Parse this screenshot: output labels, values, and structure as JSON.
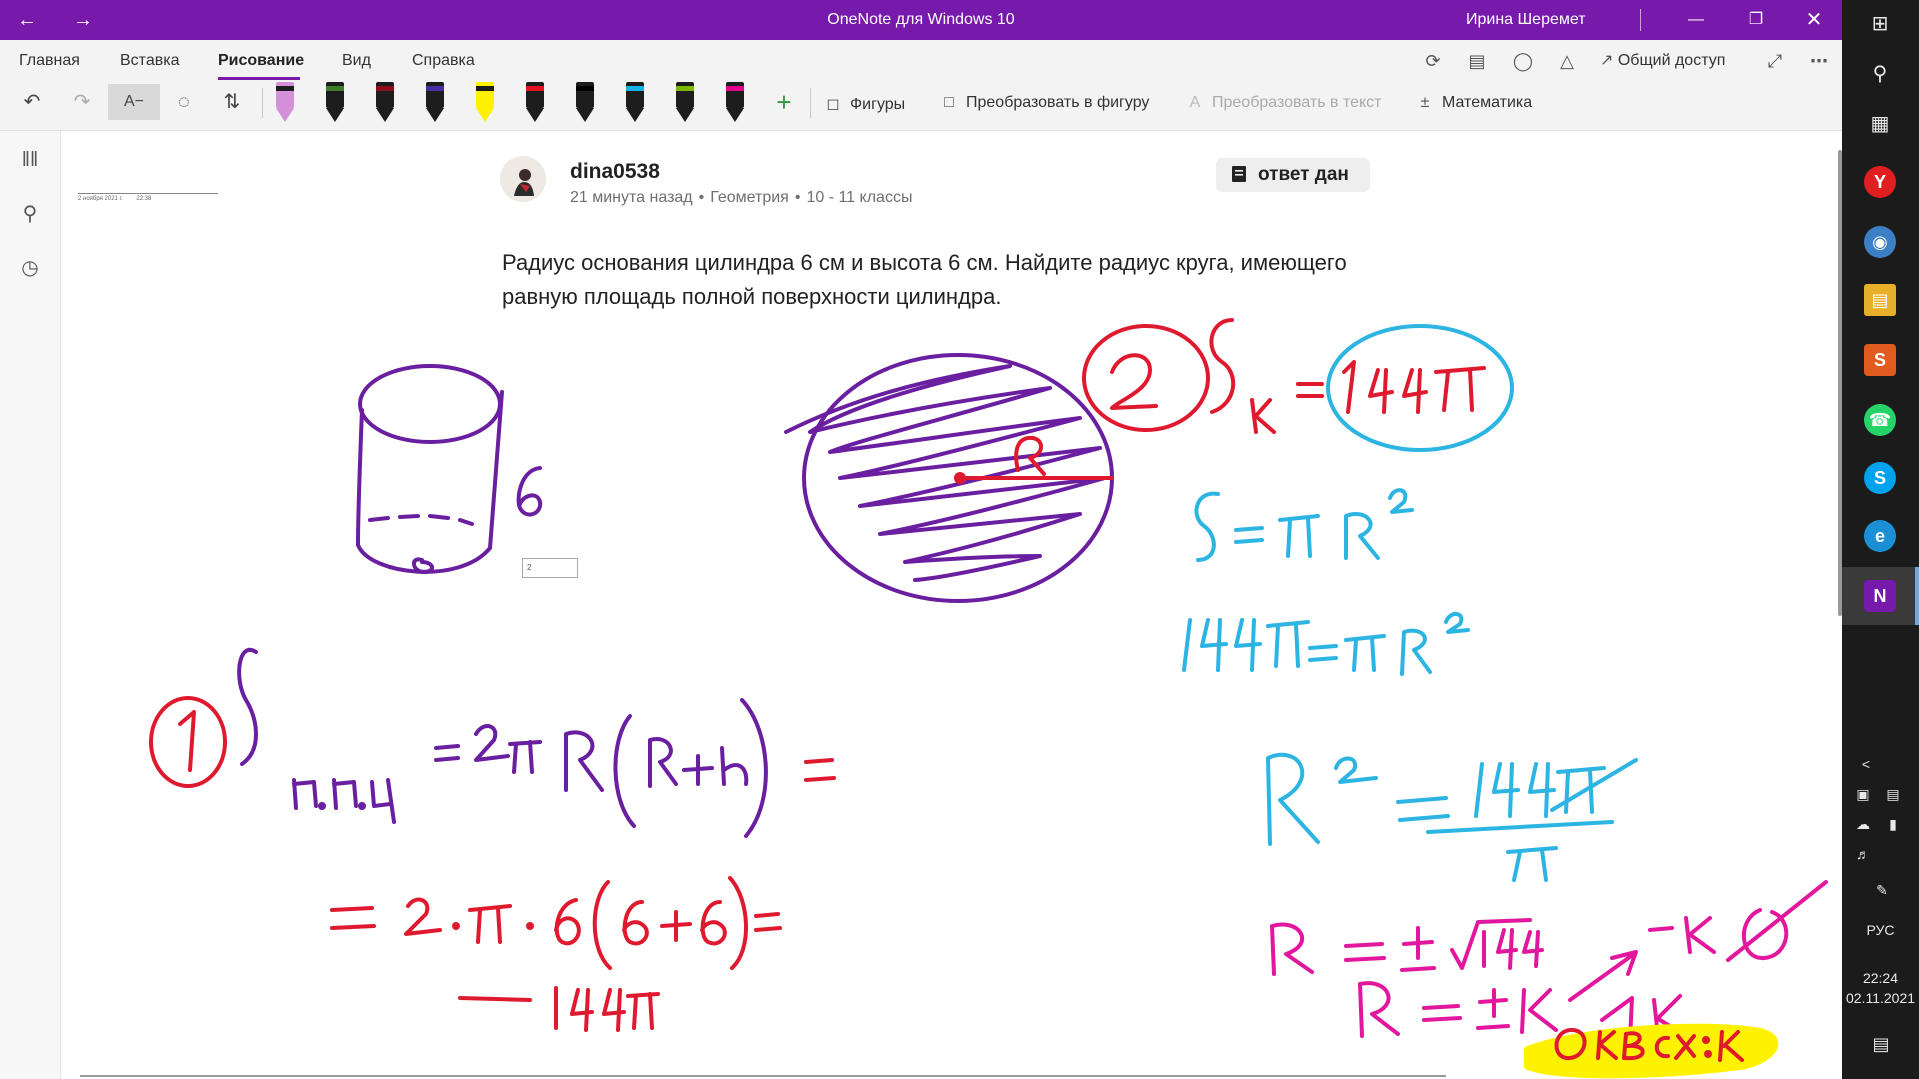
{
  "window": {
    "title": "OneNote для Windows 10",
    "user": "Ирина Шеремет",
    "accent": "#7719aa"
  },
  "ribbon": {
    "tabs": [
      "Главная",
      "Вставка",
      "Рисование",
      "Вид",
      "Справка"
    ],
    "active_tab": "Рисование",
    "share_label": "Общий доступ",
    "shapes_label": "Фигуры",
    "ink_to_shape_label": "Преобразовать в фигуру",
    "ink_to_text_label": "Преобразовать в текст",
    "math_label": "Математика",
    "pens": [
      {
        "name": "highlighter-pink",
        "color": "#d38fd8"
      },
      {
        "name": "galaxy-pen",
        "color": "#3e7d2a"
      },
      {
        "name": "pen-dark-red",
        "color": "#8b0e1a"
      },
      {
        "name": "pen-purple",
        "color": "#4a2ea8"
      },
      {
        "name": "highlighter-yellow",
        "color": "#fff100"
      },
      {
        "name": "pen-red",
        "color": "#e81123"
      },
      {
        "name": "pen-black",
        "color": "#000000"
      },
      {
        "name": "pen-light-blue",
        "color": "#12b3e6"
      },
      {
        "name": "pen-green",
        "color": "#7ab800"
      },
      {
        "name": "pen-magenta",
        "color": "#e3008c"
      }
    ]
  },
  "page": {
    "author": "dina0538",
    "time_ago": "21 минута назад",
    "subject": "Геометрия",
    "grade": "10 - 11 классы",
    "badge": "ответ дан",
    "question": "Радиус основания цилиндра 6 см и высота 6 см. Найдите радиус круга, имеющего равную площадь полной поверхности цилиндра.",
    "stamp_date": "2 ноября 2021 г.",
    "stamp_time": "22:38",
    "mini_input_value": "2"
  },
  "ink_colors": {
    "purple": "#6a1fa0",
    "red": "#e01a2e",
    "blue": "#2cb4e3",
    "magenta": "#e3179d",
    "highlight": "#fff200"
  },
  "taskbar": {
    "language": "РУС",
    "time": "22:24",
    "date": "02.11.2021"
  }
}
